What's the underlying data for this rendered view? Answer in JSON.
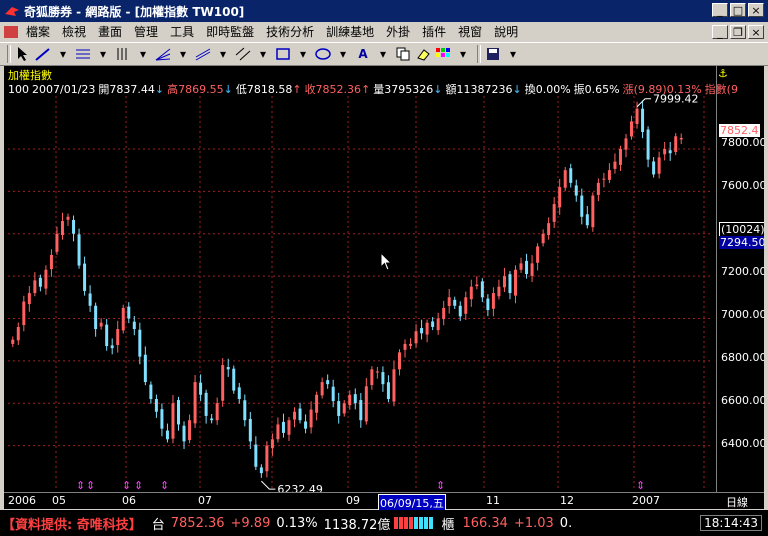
{
  "window": {
    "title": "奇狐勝券 - 網路版 - [加權指數 TW100]"
  },
  "menu": [
    "檔案",
    "檢視",
    "畫面",
    "管理",
    "工具",
    "即時監盤",
    "技術分析",
    "訓練基地",
    "外掛",
    "插件",
    "視窗",
    "說明"
  ],
  "chart_header": {
    "name": "加權指數",
    "info": [
      {
        "text": "100",
        "color": "#ffffff"
      },
      {
        "text": "2007/01/23",
        "color": "#ffffff"
      },
      {
        "text": "開7837.44",
        "color": "#ffffff"
      },
      {
        "text": "↓",
        "color": "#40c0ff"
      },
      {
        "text": "高7869.55",
        "color": "#ff6060"
      },
      {
        "text": "↓",
        "color": "#40c0ff"
      },
      {
        "text": "低7818.58",
        "color": "#ffffff"
      },
      {
        "text": "↑",
        "color": "#ff6060"
      },
      {
        "text": "收7852.36",
        "color": "#ff6060"
      },
      {
        "text": "↑",
        "color": "#ff6060"
      },
      {
        "text": "量3795326",
        "color": "#ffffff"
      },
      {
        "text": "↓",
        "color": "#40c0ff"
      },
      {
        "text": "額11387236",
        "color": "#ffffff"
      },
      {
        "text": "↓",
        "color": "#40c0ff"
      },
      {
        "text": "換0.00%",
        "color": "#ffffff"
      },
      {
        "text": "振0.65%",
        "color": "#ffffff"
      },
      {
        "text": "漲(9.89)0.13%",
        "color": "#ff6060"
      },
      {
        "text": "指數(9",
        "color": "#ff6060"
      }
    ]
  },
  "chart_data": {
    "type": "candlestick",
    "ylim": [
      6200,
      8050
    ],
    "yticks": [
      6400,
      6600,
      6800,
      7000,
      7200,
      7400,
      7600,
      7800
    ],
    "ytick_labels": [
      "6400.00",
      "6600.00",
      "6800.00",
      "7000.00",
      "7200.00",
      "7294.50",
      "7600.00",
      "7800.00"
    ],
    "current_price_label": "7852.4",
    "reference_label": "(10024)",
    "x_labels": [
      "2006",
      "05",
      "06",
      "07",
      "09",
      "06/09/15,五",
      "11",
      "12",
      "2007"
    ],
    "x_axis_unit": "日線",
    "annotations": [
      {
        "text": "7999.42",
        "type": "high"
      },
      {
        "text": "6232.49",
        "type": "low"
      }
    ],
    "series_close": [
      6900,
      6960,
      7080,
      7120,
      7180,
      7150,
      7230,
      7300,
      7400,
      7460,
      7480,
      7400,
      7250,
      7130,
      7060,
      6950,
      6980,
      6870,
      6860,
      6950,
      7050,
      7000,
      6950,
      6820,
      6700,
      6620,
      6560,
      6480,
      6430,
      6600,
      6500,
      6420,
      6520,
      6700,
      6640,
      6540,
      6520,
      6600,
      6780,
      6760,
      6660,
      6620,
      6520,
      6420,
      6300,
      6270,
      6400,
      6430,
      6500,
      6460,
      6520,
      6560,
      6520,
      6480,
      6570,
      6640,
      6700,
      6690,
      6610,
      6540,
      6600,
      6640,
      6600,
      6520,
      6680,
      6760,
      6750,
      6690,
      6620,
      6760,
      6840,
      6880,
      6880,
      6940,
      6930,
      6980,
      6960,
      7000,
      7050,
      7100,
      7060,
      7010,
      7100,
      7150,
      7160,
      7100,
      7040,
      7120,
      7150,
      7200,
      7120,
      7230,
      7260,
      7210,
      7260,
      7340,
      7400,
      7450,
      7540,
      7620,
      7700,
      7640,
      7580,
      7480,
      7440,
      7580,
      7640,
      7660,
      7700,
      7740,
      7800,
      7850,
      7930,
      7990,
      7880,
      7750,
      7680,
      7760,
      7800,
      7780,
      7860,
      7852
    ]
  },
  "status": {
    "provider": "【資料提供: 奇唯科技】",
    "idx_name": "台",
    "idx_price": "7852.36",
    "idx_change": "+9.89",
    "idx_pct": "0.13%",
    "idx_amount": "1138.72億",
    "otc_name": "櫃",
    "otc_price": "166.34",
    "otc_change": "+1.03",
    "otc_pct": "0.",
    "clock": "18:14:43"
  },
  "colors": {
    "up": "#ff6060",
    "down": "#80e0ff",
    "marker": "#ff40ff"
  }
}
